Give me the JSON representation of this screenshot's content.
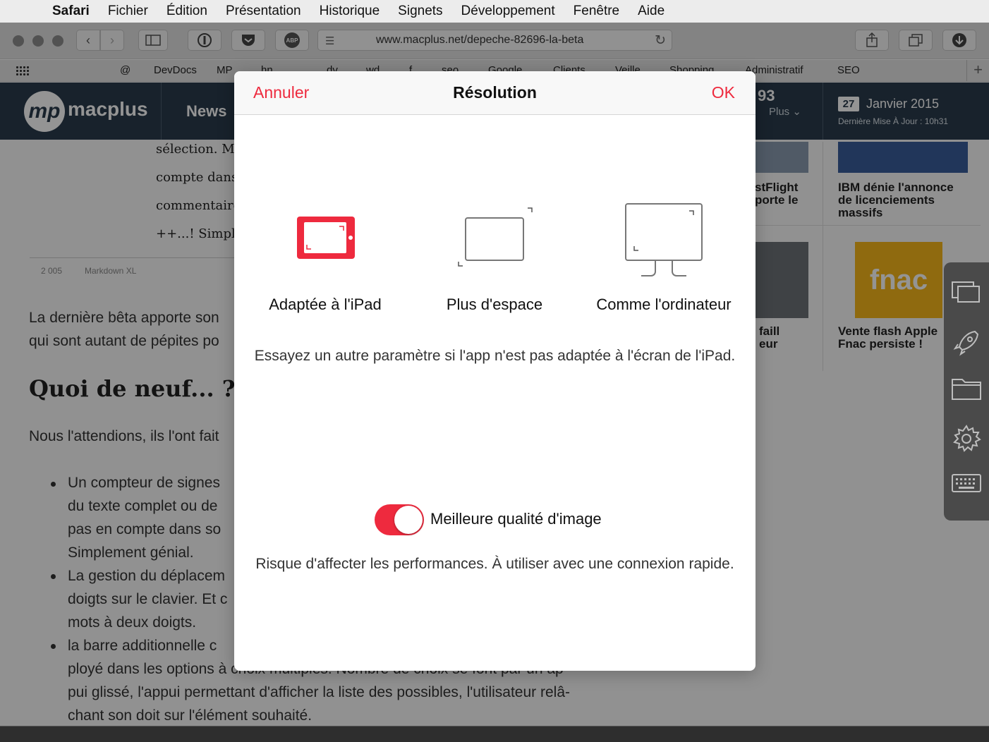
{
  "menubar": {
    "app": "Safari",
    "items": [
      "Fichier",
      "Édition",
      "Présentation",
      "Historique",
      "Signets",
      "Développement",
      "Fenêtre",
      "Aide"
    ]
  },
  "toolbar": {
    "url": "www.macplus.net/depeche-82696-la-beta",
    "icons": [
      "back-icon",
      "forward-icon",
      "sidebar-icon",
      "onepassword-icon",
      "pocket-icon",
      "adblock-icon",
      "reader-icon",
      "reload-icon",
      "share-icon",
      "tabs-icon",
      "download-icon"
    ],
    "adblock_label": "ABP"
  },
  "bookmarks": {
    "items": [
      "@",
      "DevDocs",
      "MP",
      "hn",
      "dv",
      "wd",
      "f",
      "seo",
      "Google",
      "Clients",
      "Veille",
      "Shopping",
      "Administratif",
      "SEO"
    ],
    "add_label": "+"
  },
  "site": {
    "logo_letters": "mp",
    "logo_text": "macplus",
    "nav_news": "News",
    "header_number": "93",
    "header_more": "Plus",
    "date_day": "27",
    "date_text": "Janvier 2015",
    "update_text": "Dernière Mise À Jour : 10h31",
    "serif_lines": [
      "sélection. M",
      "compte dans",
      "commentaire",
      "++...! Simplem"
    ],
    "stats": [
      "2 005",
      "Markdown XL"
    ],
    "intro_lines": [
      "La dernière bêta apporte son",
      "qui sont autant de pépites po"
    ],
    "heading": "Quoi de neuf... ?",
    "para": "Nous l'attendions, ils l'ont fait",
    "bullets": [
      [
        "Un compteur de signes",
        "du texte complet ou de",
        "pas en compte dans so",
        "Simplement génial."
      ],
      [
        "La gestion du déplacem",
        "doigts sur le clavier. Et c",
        "mots à deux doigts."
      ],
      [
        "la barre additionnelle c",
        "ployé dans les options à choix multiples. Nombre de choix se font par un ap",
        "pui glissé, l'appui permettant d'afficher la liste des possibles, l'utilisateur relâ-",
        "chant son doit sur l'élément souhaité."
      ]
    ],
    "cards": [
      {
        "title": [
          "stFlight",
          "porte le"
        ]
      },
      {
        "title": [
          "IBM dénie l'annonce",
          "de licenciements",
          "massifs"
        ]
      },
      {
        "title": [
          "faill",
          "eur"
        ]
      },
      {
        "title": [
          "Vente flash Apple",
          "Fnac persiste !"
        ]
      }
    ],
    "fnac_logo": "fnac"
  },
  "dock": {
    "icons": [
      "windows-icon",
      "rocket-icon",
      "folder-icon",
      "gear-icon",
      "keyboard-icon"
    ]
  },
  "modal": {
    "cancel": "Annuler",
    "title": "Résolution",
    "ok": "OK",
    "accent": "#ee2a3e",
    "options": [
      {
        "label": "Adaptée à l'iPad",
        "icon": "ipad-icon",
        "selected": true
      },
      {
        "label": "Plus d'espace",
        "icon": "more-space-icon",
        "selected": false
      },
      {
        "label": "Comme l'ordinateur",
        "icon": "monitor-icon",
        "selected": false
      }
    ],
    "hint": "Essayez un autre paramètre si l'app n'est pas adaptée à l'écran de l'iPad.",
    "toggle_label": "Meilleure qualité d'image",
    "toggle_on": true,
    "perf_note": "Risque d'affecter les performances. À utiliser avec une connexion rapide."
  }
}
